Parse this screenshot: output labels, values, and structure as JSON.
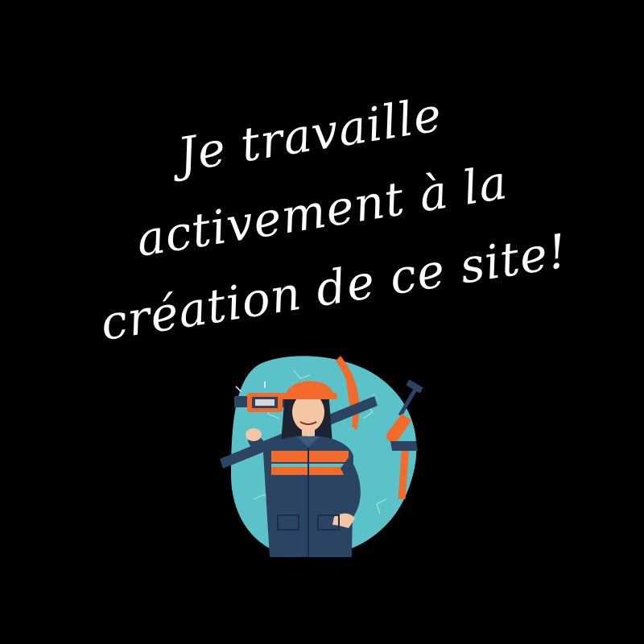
{
  "message": {
    "lines": [
      "Je travaille",
      "activement à la",
      "création de ce site!"
    ],
    "color": "#ffffff"
  },
  "background_color": "#000000",
  "illustration": {
    "subject": "construction-worker",
    "colors": {
      "blob": "#5cc2c9",
      "accent": "#f26b2a",
      "navy": "#2b4463",
      "skin": "#f4c6a3",
      "hair": "#1c2331"
    },
    "tools": [
      "pickaxe-icon",
      "trowel-icon",
      "hammer-icon",
      "welding-mask-icon"
    ]
  }
}
